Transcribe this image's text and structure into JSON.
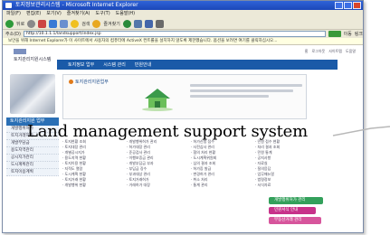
{
  "window": {
    "title": "토지정보관리시스템 - Microsoft Internet Explorer",
    "menu": [
      "파일(F)",
      "편집(E)",
      "보기(V)",
      "즐겨찾기(A)",
      "도구(T)",
      "도움말(H)"
    ],
    "toolbar": {
      "back_label": "뒤로",
      "search_label": "검색",
      "favorites_label": "즐겨찾기"
    },
    "address_label": "주소(D)",
    "address_value": "http://10.1.1.1/landsupport/index.jsp",
    "go_label": "이동",
    "links_label": "링크",
    "infobar_text": "보안을 위해 Internet Explorer가 이 사이트에서 사용자의 컴퓨터에 ActiveX 컨트롤을 설치하지 않도록 제한했습니다. 옵션을 보려면 여기를 클릭하십시오..."
  },
  "site": {
    "logo_text": "토지관리지원시스템",
    "top_links": [
      "홈",
      "로그아웃",
      "사이트맵",
      "도움말"
    ],
    "tabs": [
      "토지정보 업무",
      "시스템 관리",
      "민원안내"
    ],
    "sidebar": {
      "menu_title": "토지관리지원 업무",
      "items": [
        "개발행위허가",
        "토지거래허가",
        "개발부담금",
        "용도지역관리",
        "공시지가관리",
        "도시계획관리",
        "토지이용계획"
      ]
    },
    "intro": {
      "title": "토지관리지원업무"
    },
    "columns": [
      [
        "· 토지현황 조회",
        "· 토지대장 관리",
        "· 개별공시지가",
        "· 용도지역 현황",
        "· 토지이용 현황",
        "· 지적도 열람",
        "· 도시계획 현황",
        "· 토지거래 현황",
        "· 개발행위 현황"
      ],
      [
        "· 개발행위허가 관리",
        "· 허가대장 관리",
        "· 준공검사 관리",
        "· 이행보증금 관리",
        "· 개발부담금 부과",
        "· 부담금 징수",
        "· 부과대상 관리",
        "· 토지거래허가",
        "· 거래허가 대장"
      ],
      [
        "· 허가신청 접수",
        "· 사전심사 관리",
        "· 협의 처리 현황",
        "· 도시계획위원회",
        "· 심의 결과 조회",
        "· 허가증 발급",
        "· 변경허가 관리",
        "· 취소 처리",
        "· 통계 관리"
      ],
      [
        "· 민원 접수 현황",
        "· 처리 결과 조회",
        "· 민원 통계",
        "· 공지사항",
        "· 자료실",
        "· 질의응답",
        "· 업무매뉴얼",
        "· 법령정보",
        "· 서식자료"
      ]
    ],
    "right_panel": [
      "개발행위허가 관리",
      "민원서식 안내",
      "부동산거래 관리"
    ]
  },
  "caption": "Land management support system"
}
